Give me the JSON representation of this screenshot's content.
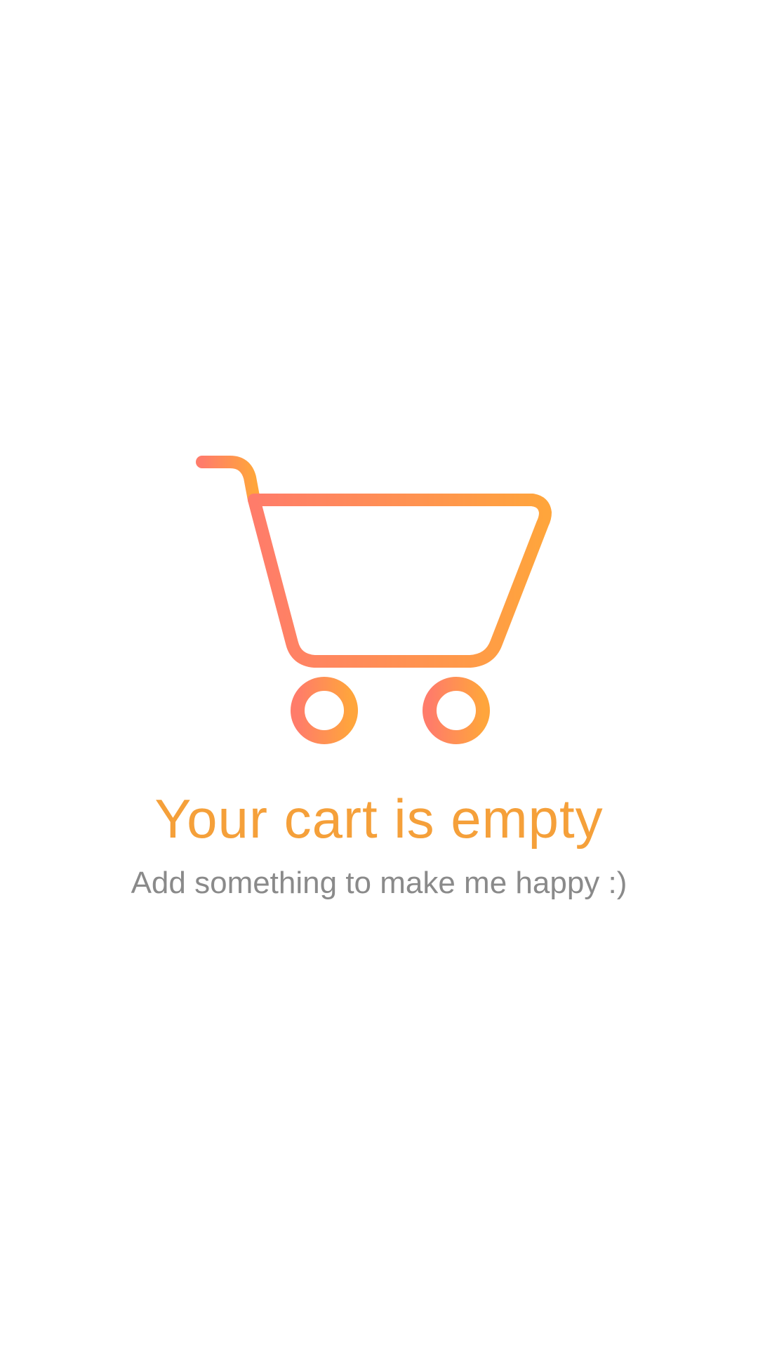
{
  "empty_cart": {
    "title": "Your cart is empty",
    "subtitle": "Add something to make me happy :)",
    "icon": "shopping-cart-icon"
  },
  "colors": {
    "gradient_start": "#ff7c6a",
    "gradient_end": "#ffa53c",
    "title": "#f5a03a",
    "subtitle": "#8a8a8a",
    "background": "#ffffff"
  }
}
